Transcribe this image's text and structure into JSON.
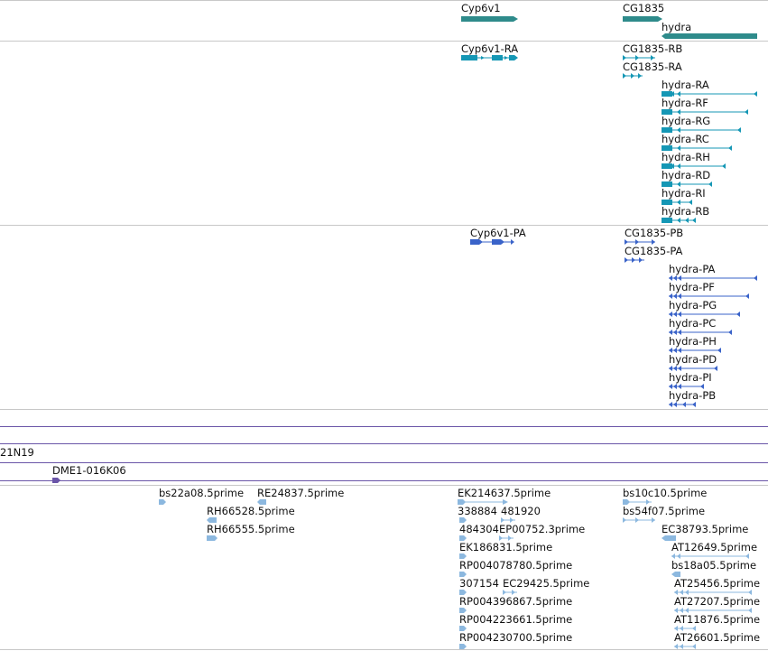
{
  "colors": {
    "gene": "#2e8b8b",
    "transcript": "#1597b5",
    "protein": "#3a63c9",
    "purple_line": "#6a55a8",
    "est": "#8cb8df",
    "separator": "#c8c8c8"
  },
  "tracks": {
    "genes": [
      {
        "label": "Cyp6v1",
        "icon": "gene-bar-right"
      },
      {
        "label": "CG1835",
        "icon": "gene-bar-right"
      },
      {
        "label": "hydra",
        "icon": "gene-bar-left"
      }
    ],
    "transcripts": [
      {
        "label": "Cyp6v1-RA"
      },
      {
        "label": "CG1835-RB"
      },
      {
        "label": "CG1835-RA"
      },
      {
        "label": "hydra-RA"
      },
      {
        "label": "hydra-RF"
      },
      {
        "label": "hydra-RG"
      },
      {
        "label": "hydra-RC"
      },
      {
        "label": "hydra-RH"
      },
      {
        "label": "hydra-RD"
      },
      {
        "label": "hydra-RI"
      },
      {
        "label": "hydra-RB"
      }
    ],
    "proteins": [
      {
        "label": "Cyp6v1-PA"
      },
      {
        "label": "CG1835-PB"
      },
      {
        "label": "CG1835-PA"
      },
      {
        "label": "hydra-PA"
      },
      {
        "label": "hydra-PF"
      },
      {
        "label": "hydra-PG"
      },
      {
        "label": "hydra-PC"
      },
      {
        "label": "hydra-PH"
      },
      {
        "label": "hydra-PD"
      },
      {
        "label": "hydra-PI"
      },
      {
        "label": "hydra-PB"
      }
    ],
    "clones": [
      {
        "label": "21N19"
      },
      {
        "label": "DME1-016K06"
      }
    ],
    "ests": [
      {
        "label": "bs22a08.5prime"
      },
      {
        "label": "RE24837.5prime"
      },
      {
        "label": "RH66528.5prime"
      },
      {
        "label": "RH66555.5prime"
      },
      {
        "label": "EK214637.5prime"
      },
      {
        "label": "338884"
      },
      {
        "label": "481920"
      },
      {
        "label": "484304"
      },
      {
        "label": "EP00752.3prime"
      },
      {
        "label": "EK186831.5prime"
      },
      {
        "label": "RP004078780.5prime"
      },
      {
        "label": "307154"
      },
      {
        "label": "EC29425.5prime"
      },
      {
        "label": "RP004396867.5prime"
      },
      {
        "label": "RP004223661.5prime"
      },
      {
        "label": "RP004230700.5prime"
      },
      {
        "label": "bs10c10.5prime"
      },
      {
        "label": "bs54f07.5prime"
      },
      {
        "label": "EC38793.5prime"
      },
      {
        "label": "AT12649.5prime"
      },
      {
        "label": "bs18a05.5prime"
      },
      {
        "label": "AT25456.5prime"
      },
      {
        "label": "AT27207.5prime"
      },
      {
        "label": "AT11876.5prime"
      },
      {
        "label": "AT26601.5prime"
      }
    ]
  }
}
